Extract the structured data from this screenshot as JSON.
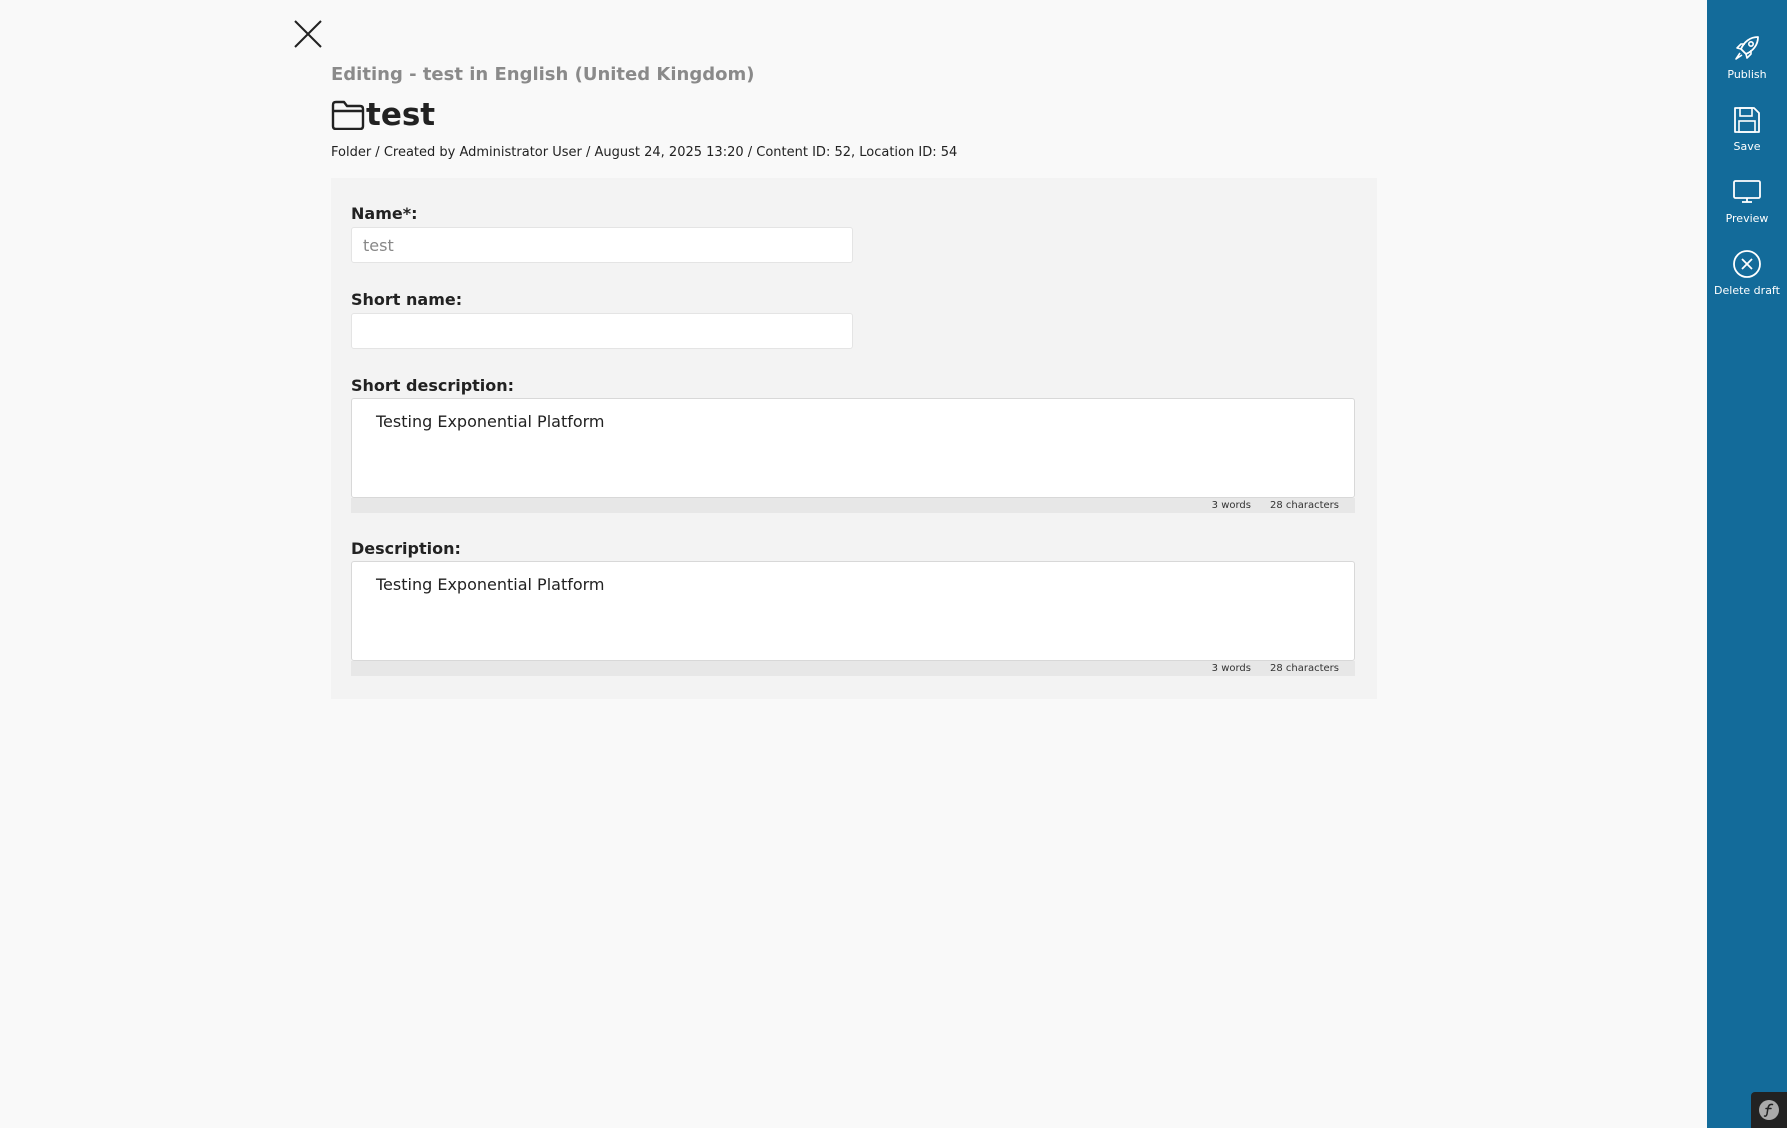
{
  "header": {
    "editing_title": "Editing - test in English (United Kingdom)",
    "content_name": "test",
    "meta": "Folder / Created by Administrator User / August 24, 2025 13:20 / Content ID: 52, Location ID: 54"
  },
  "form": {
    "name": {
      "label": "Name*:",
      "value": "test"
    },
    "short_name": {
      "label": "Short name:",
      "value": ""
    },
    "short_description": {
      "label": "Short description:",
      "value": "Testing Exponential Platform",
      "words": "3 words",
      "characters": "28 characters"
    },
    "description": {
      "label": "Description:",
      "value": "Testing Exponential Platform",
      "words": "3 words",
      "characters": "28 characters"
    }
  },
  "toolbar": {
    "publish_label": "Publish",
    "save_label": "Save",
    "preview_label": "Preview",
    "delete_draft_label": "Delete draft",
    "background": "#136b9a"
  },
  "icons": {
    "close": "close-icon",
    "folder": "folder-icon",
    "publish": "rocket-icon",
    "save": "floppy-disk-icon",
    "preview": "monitor-icon",
    "delete_draft": "circle-x-icon",
    "debug": "symfony-icon"
  }
}
